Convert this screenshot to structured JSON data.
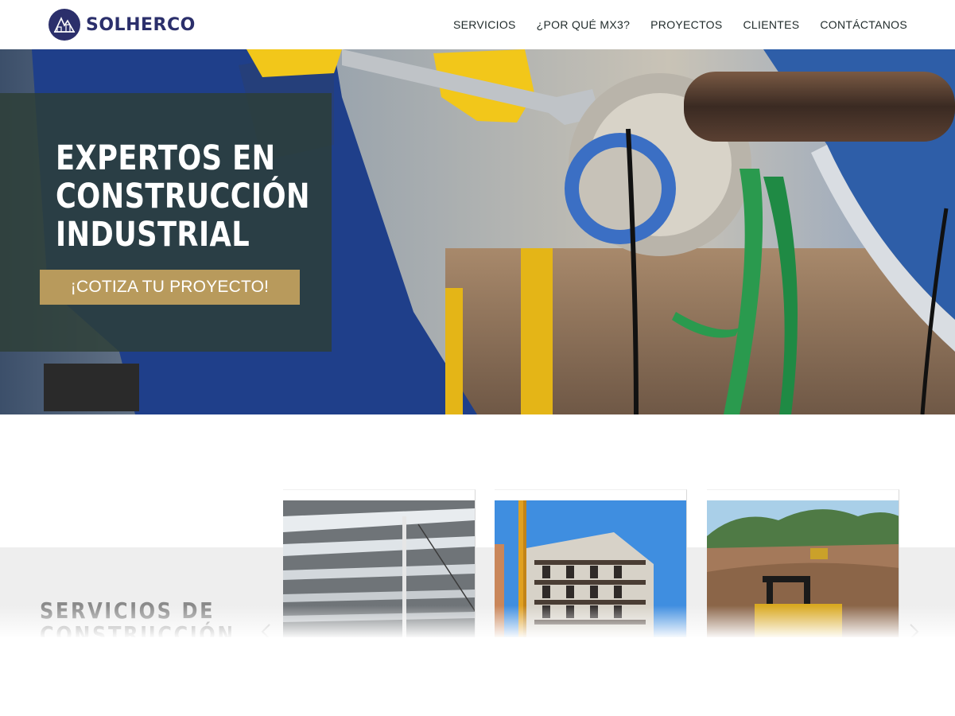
{
  "header": {
    "logo_text": "SOLHERCO",
    "nav": [
      {
        "label": "SERVICIOS"
      },
      {
        "label": "¿POR QUÉ MX3?"
      },
      {
        "label": "PROYECTOS"
      },
      {
        "label": "CLIENTES"
      },
      {
        "label": "CONTÁCTANOS"
      }
    ]
  },
  "hero": {
    "title_lines": [
      "EXPERTOS EN",
      "CONSTRUCCIÓN",
      "INDUSTRIAL"
    ],
    "cta_label": "¡COTIZA TU PROYECTO!"
  },
  "services": {
    "title_lines": [
      "SERVICIOS DE",
      "CONSTRUCCIÓN"
    ],
    "cards": [
      {
        "icon": "warehouse-roof-photo"
      },
      {
        "icon": "building-under-construction-photo"
      },
      {
        "icon": "bulldozer-earthworks-photo"
      }
    ]
  },
  "colors": {
    "brand_navy": "#2b2f6b",
    "panel_green": "#2d3e36",
    "cta_gold": "#b89a5c",
    "band_gray": "#eeeeee",
    "title_gray": "#8a8a8a"
  }
}
